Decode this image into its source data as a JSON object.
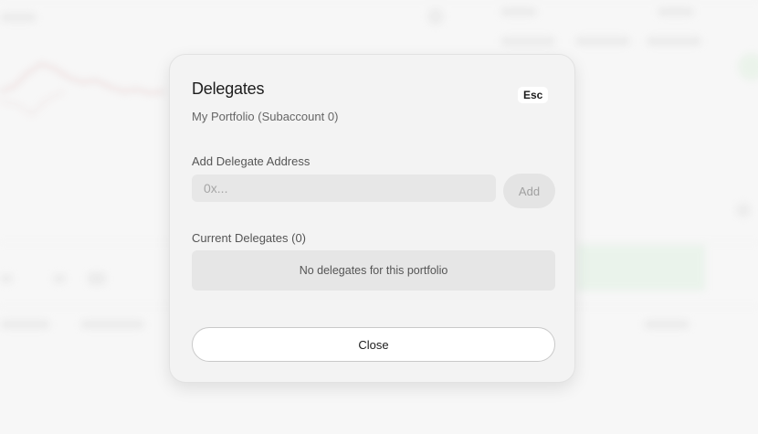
{
  "modal": {
    "title": "Delegates",
    "esc_label": "Esc",
    "subtitle": "My Portfolio (Subaccount 0)",
    "add_section": {
      "label": "Add Delegate Address",
      "input_placeholder": "0x...",
      "input_value": "",
      "add_button_label": "Add"
    },
    "current_section": {
      "label": "Current Delegates (0)",
      "empty_message": "No delegates for this portfolio"
    },
    "close_button_label": "Close"
  },
  "colors": {
    "modal_background": "#f3f3f3",
    "input_background": "#e7e7e7",
    "disabled_button": "#e4e4e4",
    "text_primary": "#1c1c1c",
    "text_muted": "#666666"
  }
}
